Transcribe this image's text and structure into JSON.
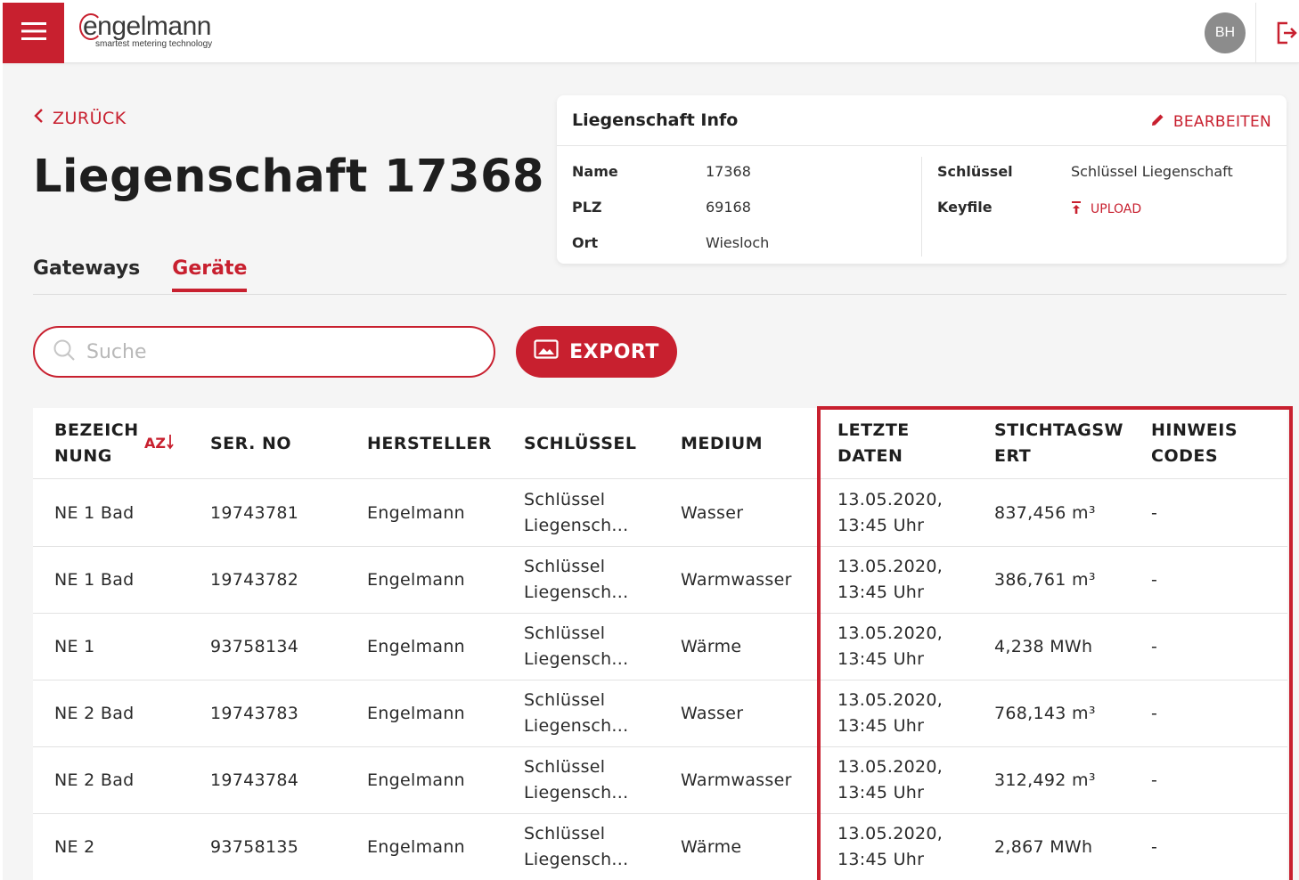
{
  "header": {
    "logo_text": "engelmann",
    "logo_tagline": "smartest metering technology",
    "avatar_initials": "BH"
  },
  "nav": {
    "back_label": "ZURÜCK"
  },
  "page": {
    "title": "Liegenschaft 17368"
  },
  "tabs": [
    {
      "label": "Gateways",
      "active": false
    },
    {
      "label": "Geräte",
      "active": true
    }
  ],
  "info": {
    "title": "Liegenschaft Info",
    "edit_label": "BEARBEITEN",
    "name_label": "Name",
    "name_value": "17368",
    "plz_label": "PLZ",
    "plz_value": "69168",
    "ort_label": "Ort",
    "ort_value": "Wiesloch",
    "key_label": "Schlüssel",
    "key_value": "Schlüssel Liegenschaft",
    "keyfile_label": "Keyfile",
    "upload_label": "UPLOAD"
  },
  "search": {
    "placeholder": "Suche",
    "value": ""
  },
  "export_label": "EXPORT",
  "table": {
    "sort_label": "AZ",
    "headers": [
      "BEZEICH\nNUNG",
      "SER. NO",
      "HERSTELLER",
      "SCHLÜSSEL",
      "MEDIUM",
      "LETZTE\nDATEN",
      "STICHTAGSW\nERT",
      "HINWEIS\nCODES"
    ],
    "rows": [
      [
        "NE 1 Bad",
        "19743781",
        "Engelmann",
        "Schlüssel\nLiegensch...",
        "Wasser",
        "13.05.2020,\n13:45 Uhr",
        "837,456 m³",
        "-"
      ],
      [
        "NE 1 Bad",
        "19743782",
        "Engelmann",
        "Schlüssel\nLiegensch...",
        "Warmwasser",
        "13.05.2020,\n13:45 Uhr",
        "386,761 m³",
        "-"
      ],
      [
        "NE 1",
        "93758134",
        "Engelmann",
        "Schlüssel\nLiegensch...",
        "Wärme",
        "13.05.2020,\n13:45 Uhr",
        "4,238 MWh",
        "-"
      ],
      [
        "NE 2 Bad",
        "19743783",
        "Engelmann",
        "Schlüssel\nLiegensch...",
        "Wasser",
        "13.05.2020,\n13:45 Uhr",
        "768,143 m³",
        "-"
      ],
      [
        "NE 2 Bad",
        "19743784",
        "Engelmann",
        "Schlüssel\nLiegensch...",
        "Warmwasser",
        "13.05.2020,\n13:45 Uhr",
        "312,492 m³",
        "-"
      ],
      [
        "NE 2",
        "93758135",
        "Engelmann",
        "Schlüssel\nLiegensch...",
        "Wärme",
        "13.05.2020,\n13:45 Uhr",
        "2,867 MWh",
        "-"
      ]
    ]
  },
  "colors": {
    "accent": "#c8202f",
    "background": "#f5f5f5"
  },
  "icons": [
    "menu-icon",
    "logout-icon",
    "chevron-left-icon",
    "pencil-icon",
    "upload-icon",
    "search-icon",
    "image-icon",
    "sort-alpha-icon"
  ]
}
